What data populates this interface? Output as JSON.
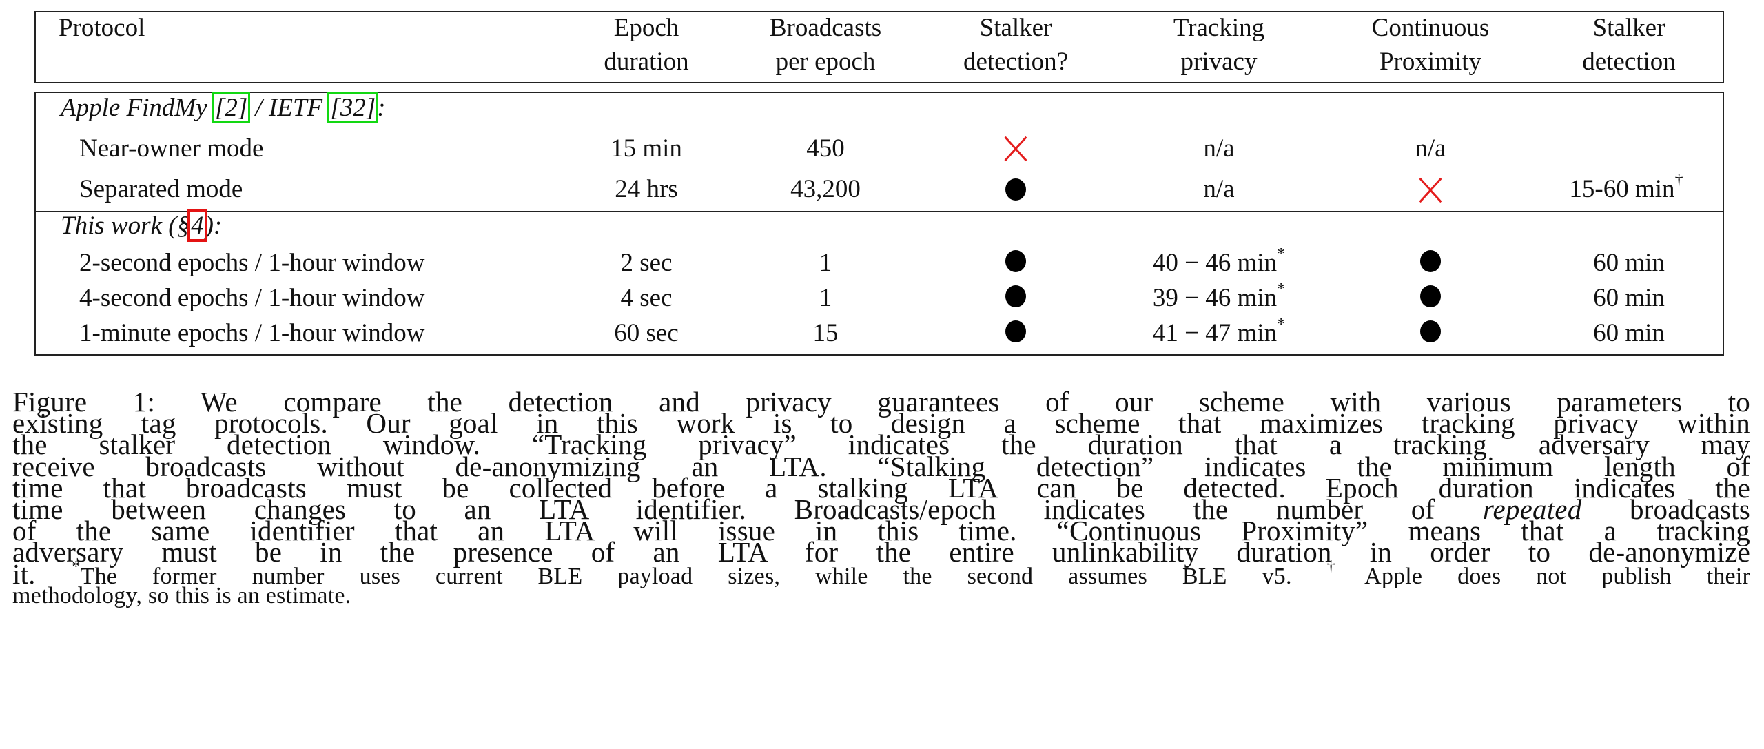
{
  "table": {
    "headers": [
      {
        "line1": "Protocol",
        "line2": ""
      },
      {
        "line1": "Epoch",
        "line2": "duration"
      },
      {
        "line1": "Broadcasts",
        "line2": "per epoch"
      },
      {
        "line1": "Stalker",
        "line2": "detection?"
      },
      {
        "line1": "Tracking",
        "line2": "privacy"
      },
      {
        "line1": "Continuous",
        "line2": "Proximity"
      },
      {
        "line1": "Stalker",
        "line2": "detection"
      }
    ],
    "sections": [
      {
        "title_prefix": "Apple FindMy ",
        "ref1": "[2]",
        "title_mid": " / IETF ",
        "ref2": "[32]",
        "title_suffix": ":",
        "rows": [
          {
            "protocol": "Near-owner mode",
            "epoch": "15 min",
            "broadcasts": "450",
            "stalker_detect": "cross",
            "tracking": "n/a",
            "proximity": "n/a",
            "proximity_mark": "",
            "stalker_time": "",
            "stalker_time_note": ""
          },
          {
            "protocol": "Separated mode",
            "epoch": "24 hrs",
            "broadcasts": "43,200",
            "stalker_detect": "dot",
            "tracking": "n/a",
            "proximity": "",
            "proximity_mark": "cross",
            "stalker_time": "15-60 min",
            "stalker_time_note": "†"
          }
        ]
      },
      {
        "title_prefix": "This work (§",
        "ref1": "4",
        "title_suffix": "):",
        "rows": [
          {
            "protocol": "2-second epochs / 1-hour window",
            "epoch": "2 sec",
            "broadcasts": "1",
            "stalker_detect": "dot",
            "tracking": "40 − 46 min",
            "tracking_note": "*",
            "proximity_mark": "dot",
            "stalker_time": "60 min"
          },
          {
            "protocol": "4-second epochs / 1-hour window",
            "epoch": "4 sec",
            "broadcasts": "1",
            "stalker_detect": "dot",
            "tracking": "39 − 46 min",
            "tracking_note": "*",
            "proximity_mark": "dot",
            "stalker_time": "60 min"
          },
          {
            "protocol": "1-minute epochs / 1-hour window",
            "epoch": "60 sec",
            "broadcasts": "15",
            "stalker_detect": "dot",
            "tracking": "41 − 47 min",
            "tracking_note": "*",
            "proximity_mark": "dot",
            "stalker_time": "60 min"
          }
        ]
      }
    ],
    "colors": {
      "cross": "#e41c1c",
      "green_ref": "#12d812",
      "red_ref": "#e41313"
    }
  },
  "caption": {
    "lines": [
      "Figure 1:  We compare the detection and privacy guarantees of our scheme with various parameters to",
      "existing tag protocols. Our goal in this work is to design a scheme that maximizes tracking privacy within",
      "the stalker detection window.  “Tracking privacy” indicates the duration that a tracking adversary may",
      "receive broadcasts without de-anonymizing an LTA. “Stalking detection” indicates the minimum length of",
      "time that broadcasts must be collected before a stalking LTA can be detected. Epoch duration indicates the",
      "time between changes to an LTA identifier. Broadcasts/epoch indicates the number of ",
      "of the same identifier that an LTA will issue in this time.  “Continuous Proximity” means that a tracking",
      "adversary must be in the presence of an LTA for the entire unlinkability duration in order to de-anonymize"
    ],
    "line6_italic": "repeated",
    "line6_tail": " broadcasts",
    "line9_start": "it.  ",
    "footnote1_mark": "*",
    "footnote1": "The former number uses current BLE payload sizes, while the second assumes BLE v5.  ",
    "footnote2_mark": "†",
    "footnote2_a": "Apple does not publish their",
    "footnote2_b": "methodology, so this is an estimate."
  }
}
